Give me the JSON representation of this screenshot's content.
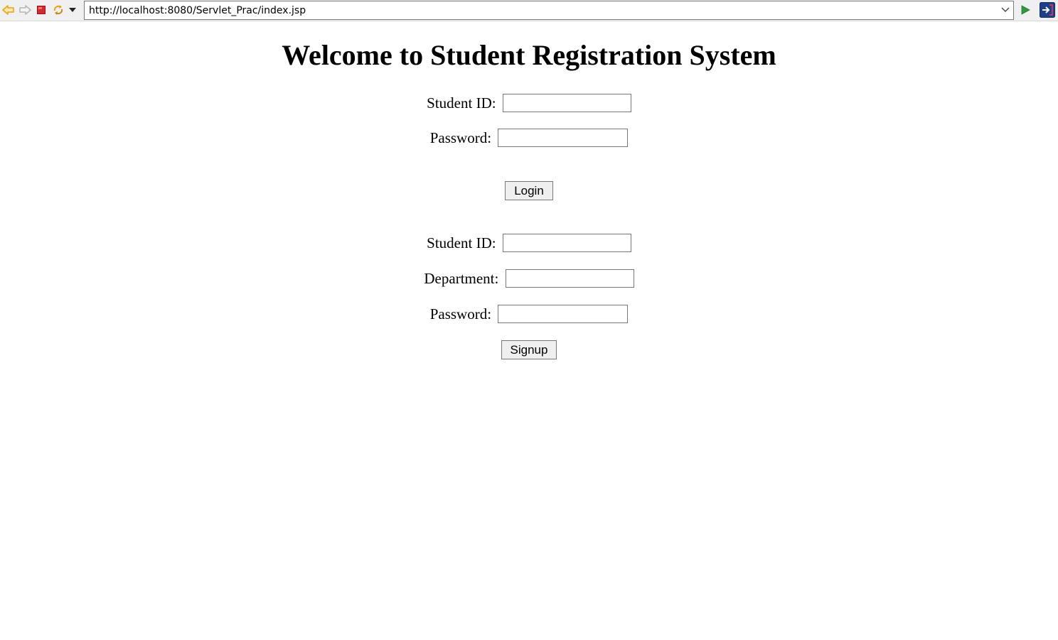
{
  "browser": {
    "url": "http://localhost:8080/Servlet_Prac/index.jsp",
    "icons": {
      "back": "back-arrow-icon",
      "forward": "forward-arrow-icon",
      "stop": "stop-icon",
      "refresh": "refresh-icon",
      "menu": "dropdown-arrow-icon",
      "go": "go-play-icon",
      "external": "external-browser-icon"
    },
    "colors": {
      "back_arrow": "#e8a317",
      "stop": "#d9272e",
      "go": "#2e9a3c",
      "external_bg": "#1f3e8c"
    }
  },
  "page": {
    "title": "Welcome to Student Registration System",
    "login": {
      "student_id_label": "Student ID:",
      "student_id_value": "",
      "password_label": "Password:",
      "password_value": "",
      "submit_label": "Login"
    },
    "signup": {
      "student_id_label": "Student ID:",
      "student_id_value": "",
      "department_label": "Department:",
      "department_value": "",
      "password_label": "Password:",
      "password_value": "",
      "submit_label": "Signup"
    }
  }
}
